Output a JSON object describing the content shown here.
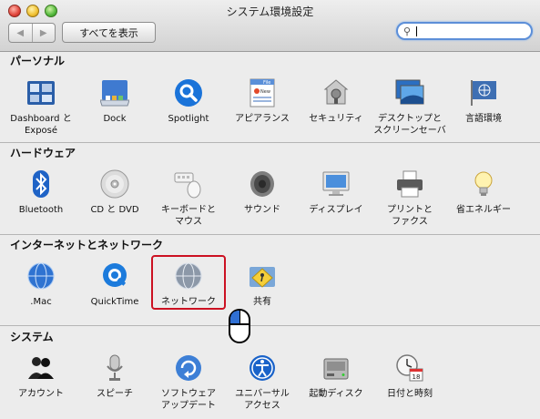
{
  "window": {
    "title": "システム環境設定"
  },
  "toolbar": {
    "back": "◀",
    "forward": "▶",
    "show_all": "すべてを表示",
    "search_placeholder": ""
  },
  "sections": [
    {
      "name": "パーソナル",
      "items": [
        {
          "label": "Dashboard と\nExposé",
          "icon": "dashboard-icon"
        },
        {
          "label": "Dock",
          "icon": "dock-icon"
        },
        {
          "label": "Spotlight",
          "icon": "spotlight-icon"
        },
        {
          "label": "アピアランス",
          "icon": "appearance-icon"
        },
        {
          "label": "セキュリティ",
          "icon": "security-icon"
        },
        {
          "label": "デスクトップと\nスクリーンセーバ",
          "icon": "desktop-icon"
        },
        {
          "label": "言語環境",
          "icon": "international-icon"
        }
      ]
    },
    {
      "name": "ハードウェア",
      "items": [
        {
          "label": "Bluetooth",
          "icon": "bluetooth-icon"
        },
        {
          "label": "CD と DVD",
          "icon": "cd-dvd-icon"
        },
        {
          "label": "キーボードと\nマウス",
          "icon": "keyboard-mouse-icon"
        },
        {
          "label": "サウンド",
          "icon": "sound-icon"
        },
        {
          "label": "ディスプレイ",
          "icon": "display-icon"
        },
        {
          "label": "プリントと\nファクス",
          "icon": "printer-icon"
        },
        {
          "label": "省エネルギー",
          "icon": "energy-icon"
        }
      ]
    },
    {
      "name": "インターネットとネットワーク",
      "items": [
        {
          "label": ".Mac",
          "icon": "mac-icon"
        },
        {
          "label": "QuickTime",
          "icon": "quicktime-icon"
        },
        {
          "label": "ネットワーク",
          "icon": "network-icon"
        },
        {
          "label": "共有",
          "icon": "sharing-icon"
        }
      ]
    },
    {
      "name": "システム",
      "items": [
        {
          "label": "アカウント",
          "icon": "accounts-icon"
        },
        {
          "label": "スピーチ",
          "icon": "speech-icon"
        },
        {
          "label": "ソフトウェア\nアップデート",
          "icon": "software-update-icon"
        },
        {
          "label": "ユニバーサル\nアクセス",
          "icon": "universal-access-icon"
        },
        {
          "label": "起動ディスク",
          "icon": "startup-disk-icon"
        },
        {
          "label": "日付と時刻",
          "icon": "date-time-icon"
        }
      ]
    }
  ],
  "date_time_icon_day": "18",
  "appearance_icon_text": {
    "file": "File",
    "new": "New"
  },
  "colors": {
    "highlight": "#cc1122",
    "search_focus": "#5d8fd8"
  }
}
